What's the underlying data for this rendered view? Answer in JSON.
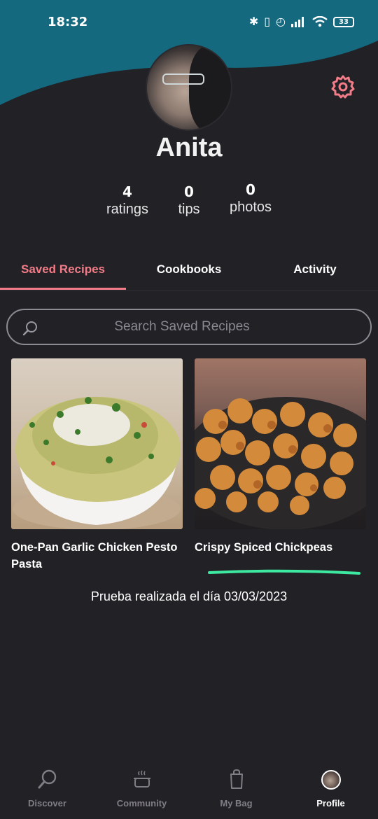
{
  "status_bar": {
    "time": "18:32",
    "battery": "33",
    "icons": [
      "bluetooth-icon",
      "vibrate-icon",
      "alarm-icon",
      "signal-icon",
      "wifi-icon",
      "battery-icon"
    ]
  },
  "profile": {
    "name": "Anita",
    "stats": [
      {
        "value": "4",
        "label": "ratings"
      },
      {
        "value": "0",
        "label": "tips"
      },
      {
        "value": "0",
        "label": "photos"
      }
    ]
  },
  "tabs": [
    {
      "label": "Saved Recipes",
      "active": true
    },
    {
      "label": "Cookbooks",
      "active": false
    },
    {
      "label": "Activity",
      "active": false
    }
  ],
  "search": {
    "placeholder": "Search Saved Recipes",
    "value": ""
  },
  "recipes": [
    {
      "title": "One-Pan Garlic Chicken Pesto Pasta"
    },
    {
      "title": "Crispy Spiced Chickpeas"
    }
  ],
  "note": "Prueba realizada el día 03/03/2023",
  "bottom_nav": [
    {
      "label": "Discover",
      "icon": "search-icon",
      "active": false
    },
    {
      "label": "Community",
      "icon": "pot-icon",
      "active": false
    },
    {
      "label": "My Bag",
      "icon": "bag-icon",
      "active": false
    },
    {
      "label": "Profile",
      "icon": "avatar-icon",
      "active": true
    }
  ],
  "colors": {
    "background": "#222126",
    "header_wave": "#15697f",
    "accent": "#f27c87",
    "highlight_mark": "#3de8a0"
  }
}
